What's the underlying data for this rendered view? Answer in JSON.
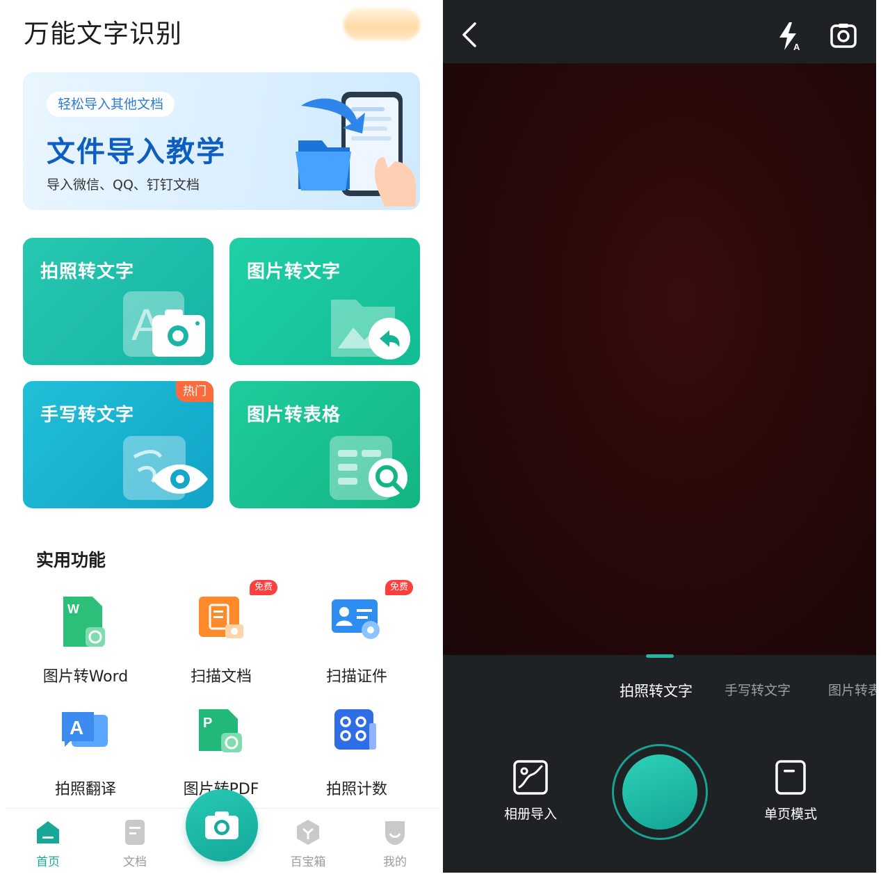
{
  "home": {
    "title": "万能文字识别",
    "banner": {
      "tag": "轻松导入其他文档",
      "title": "文件导入教学",
      "subtitle": "导入微信、QQ、钉钉文档"
    },
    "tiles": [
      {
        "label": "拍照转文字"
      },
      {
        "label": "图片转文字"
      },
      {
        "label": "手写转文字",
        "badge": "热门"
      },
      {
        "label": "图片转表格"
      }
    ],
    "section_title": "实用功能",
    "features": [
      {
        "label": "图片转Word"
      },
      {
        "label": "扫描文档",
        "badge": "免费"
      },
      {
        "label": "扫描证件",
        "badge": "免费"
      },
      {
        "label": "拍照翻译"
      },
      {
        "label": "图片转PDF"
      },
      {
        "label": "拍照计数"
      }
    ],
    "nav": [
      {
        "label": "首页"
      },
      {
        "label": "文档"
      },
      {
        "label": "百宝箱"
      },
      {
        "label": "我的"
      }
    ],
    "colors": {
      "accent": "#18a89a",
      "hot": "#ff6a3d",
      "free": "#ff3e3e"
    }
  },
  "camera": {
    "modes": [
      {
        "label": "拍照转文字"
      },
      {
        "label": "手写转文字"
      },
      {
        "label": "图片转表"
      }
    ],
    "album_label": "相册导入",
    "page_mode_label": "单页模式",
    "icons": [
      "back-icon",
      "flash-auto-icon",
      "switch-camera-icon"
    ],
    "colors": {
      "shutter": "#1fb8a4",
      "viewfinder": "#2a0909"
    }
  }
}
